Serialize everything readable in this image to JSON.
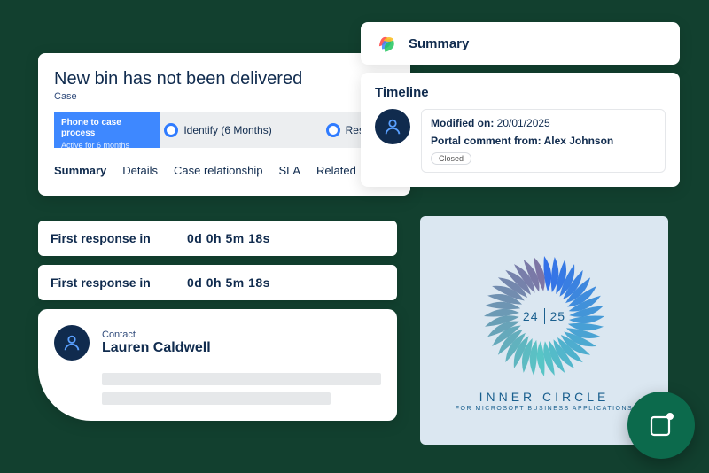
{
  "case": {
    "title": "New bin has not been delivered",
    "subtitle": "Case",
    "process": {
      "name": "Phone to case process",
      "duration": "Active for 6 months"
    },
    "steps": {
      "identify": "Identify (6 Months)",
      "research": "Research"
    },
    "tabs": [
      "Summary",
      "Details",
      "Case relationship",
      "SLA",
      "Related"
    ]
  },
  "summary": {
    "title": "Summary"
  },
  "timeline": {
    "title": "Timeline",
    "modified_label": "Modified on:",
    "modified_date": "20/01/2025",
    "comment_label": "Portal comment from:",
    "comment_author": "Alex Johnson",
    "status": "Closed"
  },
  "response": {
    "label": "First response in",
    "value": "0d  0h  5m  18s"
  },
  "contact": {
    "label": "Contact",
    "name": "Lauren Caldwell"
  },
  "badge": {
    "year_left": "24",
    "year_right": "25",
    "title": "INNER CIRCLE",
    "subtitle": "FOR MICROSOFT BUSINESS APPLICATIONS"
  }
}
